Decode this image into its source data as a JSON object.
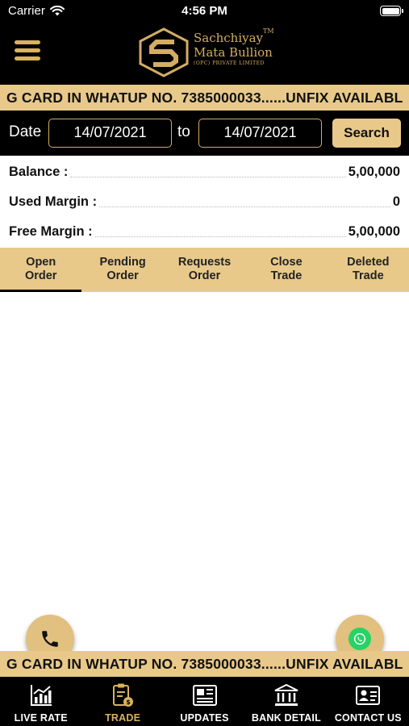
{
  "status_bar": {
    "carrier": "Carrier",
    "time": "4:56 PM"
  },
  "brand": {
    "line1": "Sachchiyay",
    "line2": "Mata Bullion",
    "line3": "(OPC) PRIVATE LIMITED",
    "tm": "TM",
    "gold": "#d4ad63"
  },
  "ticker": {
    "text": "G CARD IN WHATUP NO. 7385000033......UNFIX AVAILABL"
  },
  "date_filter": {
    "label": "Date",
    "from": "14/07/2021",
    "to_label": "to",
    "to": "14/07/2021",
    "search_label": "Search"
  },
  "summary": {
    "balance_label": "Balance :",
    "balance_value": "5,00,000",
    "used_margin_label": "Used Margin :",
    "used_margin_value": "0",
    "free_margin_label": "Free Margin :",
    "free_margin_value": "5,00,000"
  },
  "tabs": [
    {
      "label": "Open\nOrder",
      "active": true
    },
    {
      "label": "Pending\nOrder"
    },
    {
      "label": "Requests\nOrder"
    },
    {
      "label": "Close\nTrade"
    },
    {
      "label": "Deleted\nTrade"
    }
  ],
  "bottom_nav": [
    {
      "label": "LIVE RATE",
      "icon": "chart-icon"
    },
    {
      "label": "TRADE",
      "icon": "trade-icon",
      "active": true
    },
    {
      "label": "UPDATES",
      "icon": "newspaper-icon"
    },
    {
      "label": "BANK DETAIL",
      "icon": "bank-icon"
    },
    {
      "label": "CONTACT US",
      "icon": "contact-card-icon"
    }
  ],
  "colors": {
    "accent": "#e8c98a",
    "active_nav": "#d9b25b",
    "whatsapp": "#25d366"
  }
}
